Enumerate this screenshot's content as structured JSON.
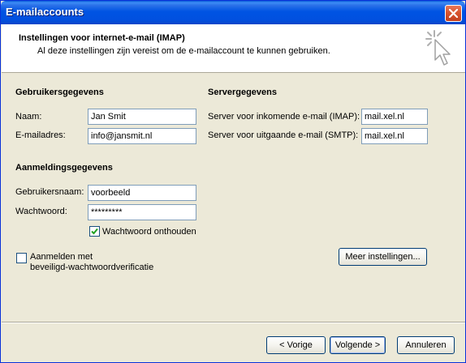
{
  "window": {
    "title": "E-mailaccounts"
  },
  "header": {
    "title": "Instellingen voor internet-e-mail (IMAP)",
    "subtitle": "Al deze instellingen zijn vereist om de e-mailaccount te kunnen gebruiken."
  },
  "user_info": {
    "heading": "Gebruikersgegevens",
    "name_label": "Naam:",
    "name_value": "Jan Smit",
    "email_label": "E-mailadres:",
    "email_value": "info@jansmit.nl"
  },
  "server_info": {
    "heading": "Servergegevens",
    "incoming_label": "Server voor inkomende e-mail (IMAP):",
    "incoming_value": "mail.xel.nl",
    "outgoing_label": "Server voor uitgaande e-mail (SMTP):",
    "outgoing_value": "mail.xel.nl"
  },
  "login_info": {
    "heading": "Aanmeldingsgegevens",
    "username_label": "Gebruikersnaam:",
    "username_value": "voorbeeld",
    "password_label": "Wachtwoord:",
    "password_value": "*********",
    "remember_label": "Wachtwoord onthouden",
    "remember_checked": true
  },
  "spa": {
    "line1": "Aanmelden met",
    "line2": "beveiligd-wachtwoordverificatie",
    "checked": false
  },
  "buttons": {
    "more_settings": "Meer instellingen...",
    "back": "< Vorige",
    "next": "Volgende >",
    "cancel": "Annuleren"
  },
  "colors": {
    "titlebar": "#0054e3",
    "dialog_bg": "#ece9d8",
    "check_green": "#21a121"
  }
}
